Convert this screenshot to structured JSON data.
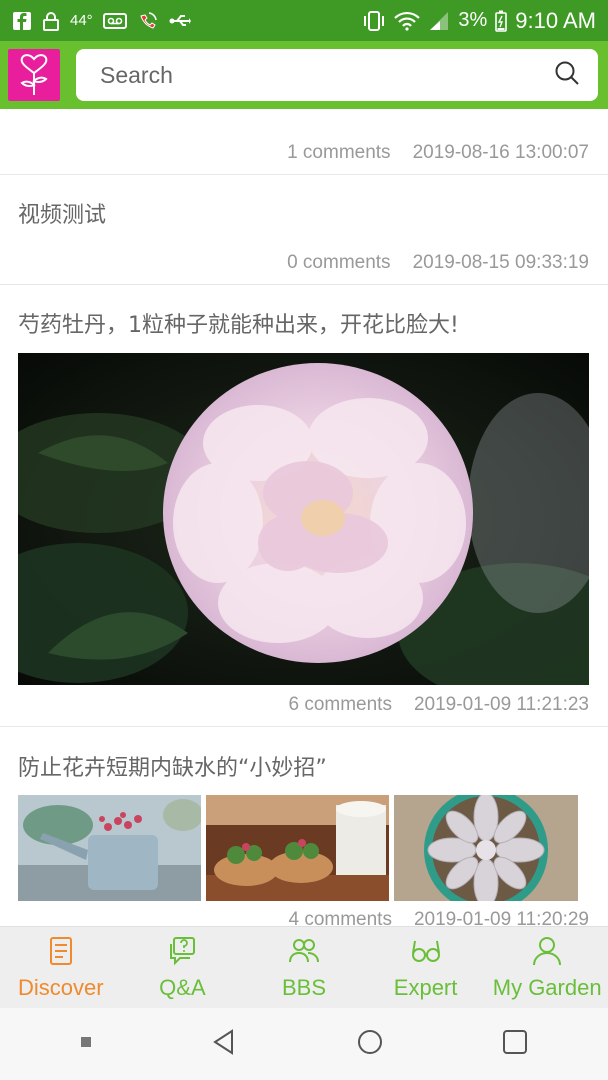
{
  "status_bar": {
    "temperature": "44°",
    "battery": "3%",
    "time": "9:10 AM"
  },
  "header": {
    "search_placeholder": "Search"
  },
  "posts": [
    {
      "title": "",
      "comments": "1 comments",
      "date": "2019-08-16 13:00:07"
    },
    {
      "title": "视频测试",
      "comments": "0 comments",
      "date": "2019-08-15 09:33:19"
    },
    {
      "title": "芍药牡丹，1粒种子就能种出来，开花比脸大!",
      "comments": "6 comments",
      "date": "2019-01-09 11:21:23"
    },
    {
      "title": "防止花卉短期内缺水的“小妙招”",
      "comments": "4 comments",
      "date": "2019-01-09 11:20:29"
    }
  ],
  "bottom_nav": [
    {
      "label": "Discover",
      "icon": "document-icon",
      "active": true
    },
    {
      "label": "Q&A",
      "icon": "question-chat-icon",
      "active": false
    },
    {
      "label": "BBS",
      "icon": "people-icon",
      "active": false
    },
    {
      "label": "Expert",
      "icon": "glasses-icon",
      "active": false
    },
    {
      "label": "My Garden",
      "icon": "person-icon",
      "active": false
    }
  ],
  "colors": {
    "status_bar": "#3e9a24",
    "header": "#68c02f",
    "logo_bg": "#e91e9c",
    "nav_active": "#f08a2e",
    "nav_inactive": "#6abf3a"
  }
}
